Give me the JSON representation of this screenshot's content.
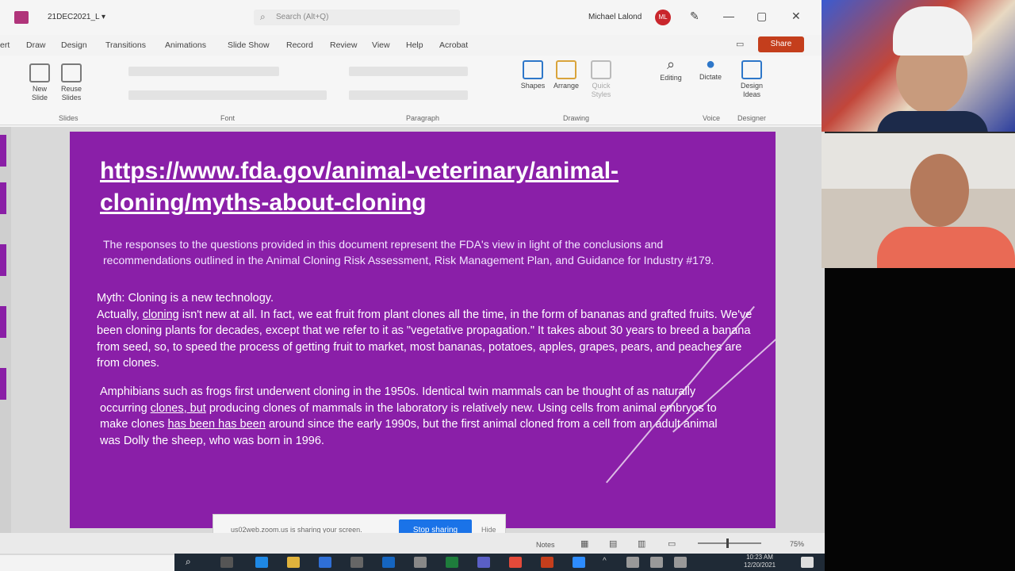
{
  "titlebar": {
    "doc_title": "21DEC2021_L ▾",
    "search_placeholder": "Search (Alt+Q)",
    "user_name": "Michael Lalond",
    "user_initials": "ML",
    "minimize": "—",
    "restore": "▢",
    "close": "✕"
  },
  "ribbon_tabs": [
    "ert",
    "Draw",
    "Design",
    "Transitions",
    "Animations",
    "Slide Show",
    "Record",
    "Review",
    "View",
    "Help",
    "Acrobat"
  ],
  "share_label": "Share",
  "ribbon": {
    "new_slide": "New Slide",
    "reuse_slides": "Reuse Slides",
    "shapes": "Shapes",
    "arrange": "Arrange",
    "quick_styles": "Quick Styles",
    "editing": "Editing",
    "dictate": "Dictate",
    "design_ideas": "Design Ideas",
    "groups": {
      "slides": "Slides",
      "font": "Font",
      "paragraph": "Paragraph",
      "drawing": "Drawing",
      "voice": "Voice",
      "designer": "Designer"
    }
  },
  "slide": {
    "link": "https://www.fda.gov/animal-veterinary/animal-cloning/myths-about-cloning",
    "intro": "The responses to the questions provided in this document represent the FDA's view in light of the conclusions and recommendations outlined in the Animal Cloning Risk Assessment, Risk Management Plan, and Guidance for Industry #179.",
    "myth_heading": "Myth: Cloning is a new technology.",
    "myth_body_1": "Actually, ",
    "myth_body_u": "cloning",
    "myth_body_2": " isn't new at all. In fact, we eat fruit from plant clones all the time, in the form of bananas and grafted fruits. We've been cloning plants for decades, except that we refer to it as \"vegetative propagation.\" It takes about 30 years to breed a banana from seed, so, to speed the process of getting fruit to market, most bananas, potatoes, apples, grapes, pears, and peaches are from clones.",
    "amph_1": "Amphibians such as frogs first underwent cloning in the 1950s. Identical twin mammals can be thought of as naturally occurring ",
    "amph_u1": "clones, but",
    "amph_2": " producing clones of mammals in the laboratory is relatively new. Using cells from animal embryos to make clones ",
    "amph_u2": "has been has been",
    "amph_3": " around since the early 1990s, but the first animal cloned from a cell from an adult animal was Dolly the sheep, who was born in 1996."
  },
  "share_banner": {
    "text": "us02web.zoom.us is sharing your screen.",
    "stop": "Stop sharing",
    "hide": "Hide"
  },
  "statusbar": {
    "notes": "Notes",
    "zoom": "75%"
  },
  "taskbar": {
    "time": "10:23 AM",
    "date": "12/20/2021"
  }
}
